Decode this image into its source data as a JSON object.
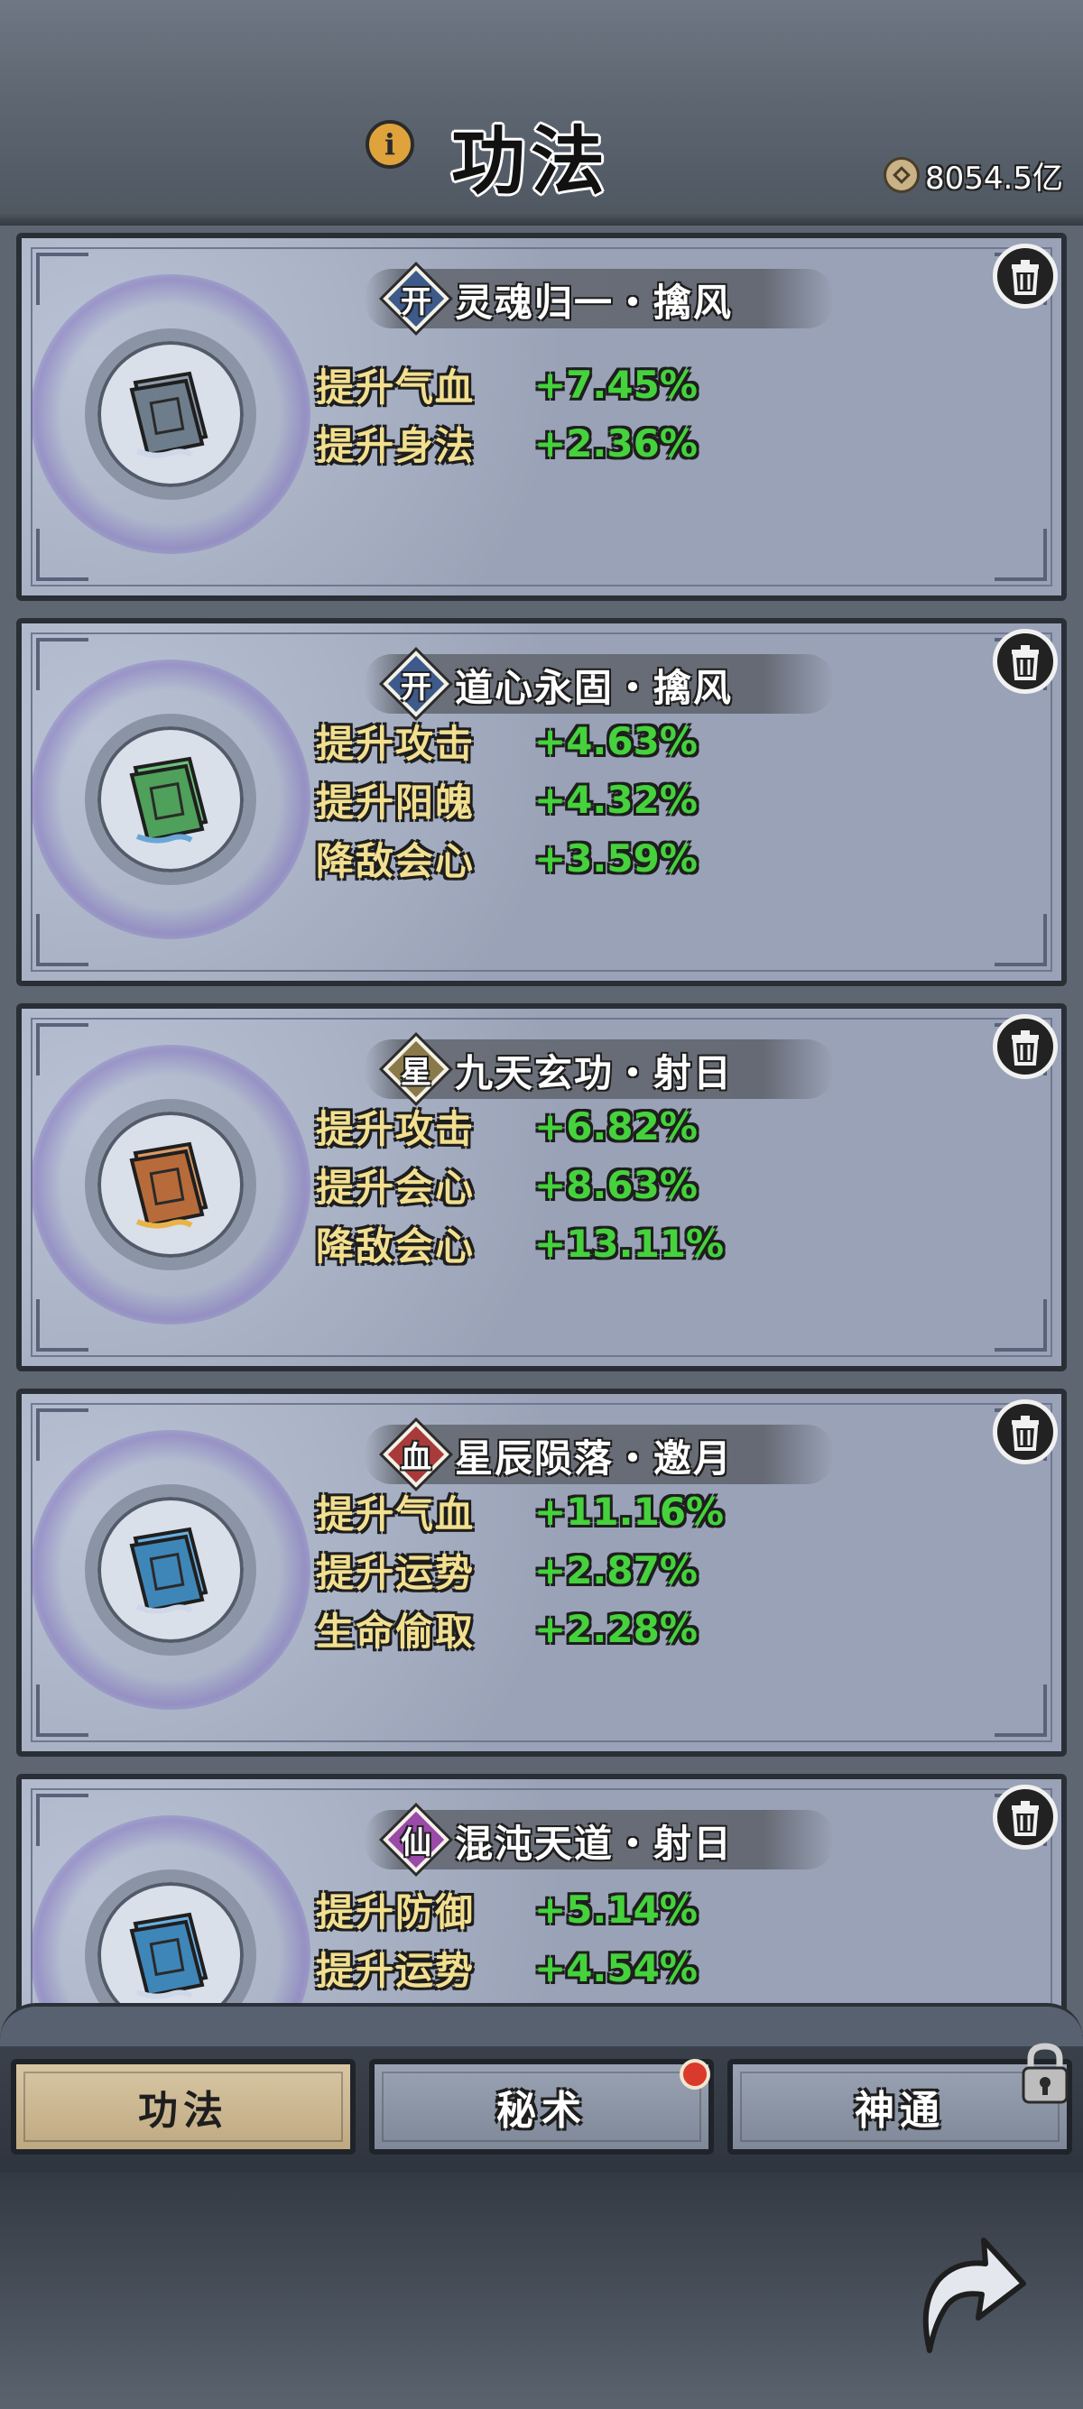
{
  "header": {
    "title": "功法",
    "info_icon": "info-icon",
    "currency": {
      "icon": "coin-icon",
      "value": "8054.5亿"
    }
  },
  "skills": [
    {
      "grade": "开",
      "grade_color": "#3d5a8a",
      "name": "灵魂归一・擒风",
      "book_color": "#6e7d8c",
      "stats": [
        {
          "label": "提升气血",
          "value": "+7.45%"
        },
        {
          "label": "提升身法",
          "value": "+2.36%"
        }
      ]
    },
    {
      "grade": "开",
      "grade_color": "#3d5a8a",
      "name": "道心永固・擒风",
      "book_color": "#4fa05a",
      "stats": [
        {
          "label": "提升攻击",
          "value": "+4.63%"
        },
        {
          "label": "提升阳魄",
          "value": "+4.32%"
        },
        {
          "label": "降敌会心",
          "value": "+3.59%"
        }
      ]
    },
    {
      "grade": "星",
      "grade_color": "#8a7a4a",
      "name": "九天玄功・射日",
      "book_color": "#b86b3a",
      "stats": [
        {
          "label": "提升攻击",
          "value": "+6.82%"
        },
        {
          "label": "提升会心",
          "value": "+8.63%"
        },
        {
          "label": "降敌会心",
          "value": "+13.11%"
        }
      ]
    },
    {
      "grade": "血",
      "grade_color": "#a83a3a",
      "name": "星辰陨落・邀月",
      "book_color": "#3f86b8",
      "stats": [
        {
          "label": "提升气血",
          "value": "+11.16%"
        },
        {
          "label": "提升运势",
          "value": "+2.87%"
        },
        {
          "label": "生命偷取",
          "value": "+2.28%"
        }
      ]
    },
    {
      "grade": "仙",
      "grade_color": "#9a4aa8",
      "name": "混沌天道・射日",
      "book_color": "#3f86b8",
      "stats": [
        {
          "label": "提升防御",
          "value": "+5.14%"
        },
        {
          "label": "提升运势",
          "value": "+4.54%"
        }
      ]
    }
  ],
  "tabs": [
    {
      "label": "功法",
      "active": true
    },
    {
      "label": "秘术",
      "active": false,
      "badge": "notification-dot"
    },
    {
      "label": "神通",
      "active": false,
      "locked": true
    }
  ],
  "footer": {
    "back_icon": "return-arrow-icon"
  }
}
